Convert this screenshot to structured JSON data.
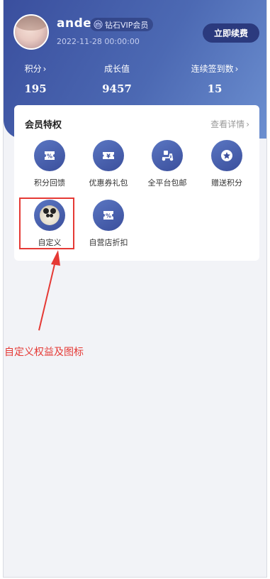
{
  "profile": {
    "username": "ande",
    "vip_level": "钻石VIP会员",
    "date": "2022-11-28 00:00:00",
    "renew_label": "立即续费"
  },
  "stats": [
    {
      "label": "积分",
      "value": "195"
    },
    {
      "label": "成长值",
      "value": "9457"
    },
    {
      "label": "连续签到数",
      "value": "15"
    }
  ],
  "perks_card": {
    "title": "会员特权",
    "more_label": "查看详情",
    "items": [
      {
        "label": "积分回馈",
        "icon": "percent-ticket-icon"
      },
      {
        "label": "优惠券礼包",
        "icon": "coupon-yen-icon"
      },
      {
        "label": "全平台包邮",
        "icon": "scooter-delivery-icon"
      },
      {
        "label": "赠送积分",
        "icon": "star-icon"
      },
      {
        "label": "自定义",
        "icon": "custom-panda-image"
      },
      {
        "label": "自营店折扣",
        "icon": "percent-ticket-icon"
      }
    ]
  },
  "annotation": {
    "text": "自定义权益及图标",
    "color": "#e53935"
  },
  "colors": {
    "header_gradient_start": "#3a4f9e",
    "header_gradient_end": "#6c8fd0",
    "icon_circle": "#4a63b0",
    "renew_button": "#2b3a7e",
    "background": "#f2f3f7"
  }
}
